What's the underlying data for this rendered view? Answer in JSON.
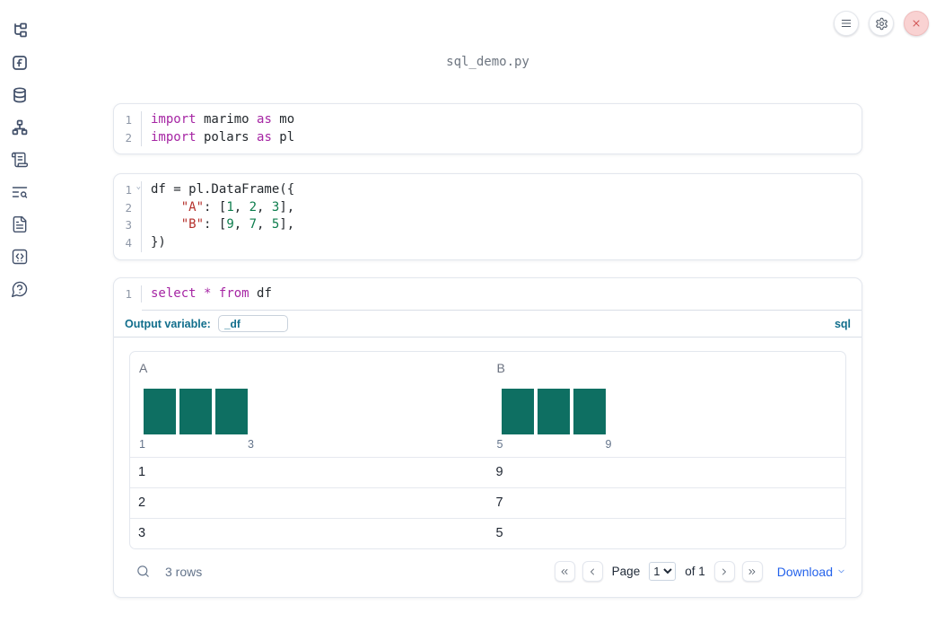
{
  "colors": {
    "histogram_bar": "#0e6f62",
    "sql_accent": "#116e8c",
    "link_blue": "#2563eb",
    "keyword": "#a626a4",
    "string": "#b5312c",
    "number": "#0d7d4d",
    "close_button_bg": "#f9d2d2",
    "close_button_icon": "#d05252"
  },
  "sidebar": {
    "icons": [
      "file-explorer",
      "variables",
      "datasources",
      "dependency-graph",
      "scratchpad-scroll",
      "logs-search",
      "documentation",
      "snippets",
      "help-chat"
    ]
  },
  "topbar": {
    "buttons": [
      "menu",
      "settings",
      "shutdown"
    ]
  },
  "header": {
    "filename": "sql_demo.py"
  },
  "cells": [
    {
      "type": "python",
      "lines": [
        [
          {
            "t": "import",
            "c": "kw"
          },
          {
            "t": " marimo ",
            "c": "pl"
          },
          {
            "t": "as",
            "c": "kw"
          },
          {
            "t": " mo",
            "c": "pl"
          }
        ],
        [
          {
            "t": "import",
            "c": "kw"
          },
          {
            "t": " polars ",
            "c": "pl"
          },
          {
            "t": "as",
            "c": "kw"
          },
          {
            "t": " pl",
            "c": "pl"
          }
        ]
      ]
    },
    {
      "type": "python",
      "fold_line": 1,
      "lines": [
        [
          {
            "t": "df = pl.DataFrame({",
            "c": "pl"
          }
        ],
        [
          {
            "t": "    ",
            "c": "pl"
          },
          {
            "t": "\"A\"",
            "c": "str"
          },
          {
            "t": ": [",
            "c": "pl"
          },
          {
            "t": "1",
            "c": "num"
          },
          {
            "t": ", ",
            "c": "pl"
          },
          {
            "t": "2",
            "c": "num"
          },
          {
            "t": ", ",
            "c": "pl"
          },
          {
            "t": "3",
            "c": "num"
          },
          {
            "t": "],",
            "c": "pl"
          }
        ],
        [
          {
            "t": "    ",
            "c": "pl"
          },
          {
            "t": "\"B\"",
            "c": "str"
          },
          {
            "t": ": [",
            "c": "pl"
          },
          {
            "t": "9",
            "c": "num"
          },
          {
            "t": ", ",
            "c": "pl"
          },
          {
            "t": "7",
            "c": "num"
          },
          {
            "t": ", ",
            "c": "pl"
          },
          {
            "t": "5",
            "c": "num"
          },
          {
            "t": "],",
            "c": "pl"
          }
        ],
        [
          {
            "t": "})",
            "c": "pl"
          }
        ]
      ]
    },
    {
      "type": "sql",
      "lines": [
        [
          {
            "t": "select",
            "c": "kw"
          },
          {
            "t": " ",
            "c": "pl"
          },
          {
            "t": "*",
            "c": "kw"
          },
          {
            "t": " ",
            "c": "pl"
          },
          {
            "t": "from",
            "c": "kw"
          },
          {
            "t": " df",
            "c": "pl"
          }
        ]
      ],
      "output_variable_label": "Output variable:",
      "output_variable_value": "_df",
      "language_badge": "sql"
    }
  ],
  "table": {
    "columns": [
      {
        "name": "A",
        "histogram": {
          "bar_count": 3,
          "bar_values": [
            1,
            1,
            1
          ],
          "min_label": "1",
          "max_label": "3"
        }
      },
      {
        "name": "B",
        "histogram": {
          "bar_count": 3,
          "bar_values": [
            1,
            1,
            1
          ],
          "min_label": "5",
          "max_label": "9"
        }
      }
    ],
    "rows": [
      [
        "1",
        "9"
      ],
      [
        "2",
        "7"
      ],
      [
        "3",
        "5"
      ]
    ],
    "footer": {
      "row_count": "3 rows",
      "page_label": "Page",
      "page_value": "1",
      "of_label": "of 1",
      "download_label": "Download"
    }
  }
}
